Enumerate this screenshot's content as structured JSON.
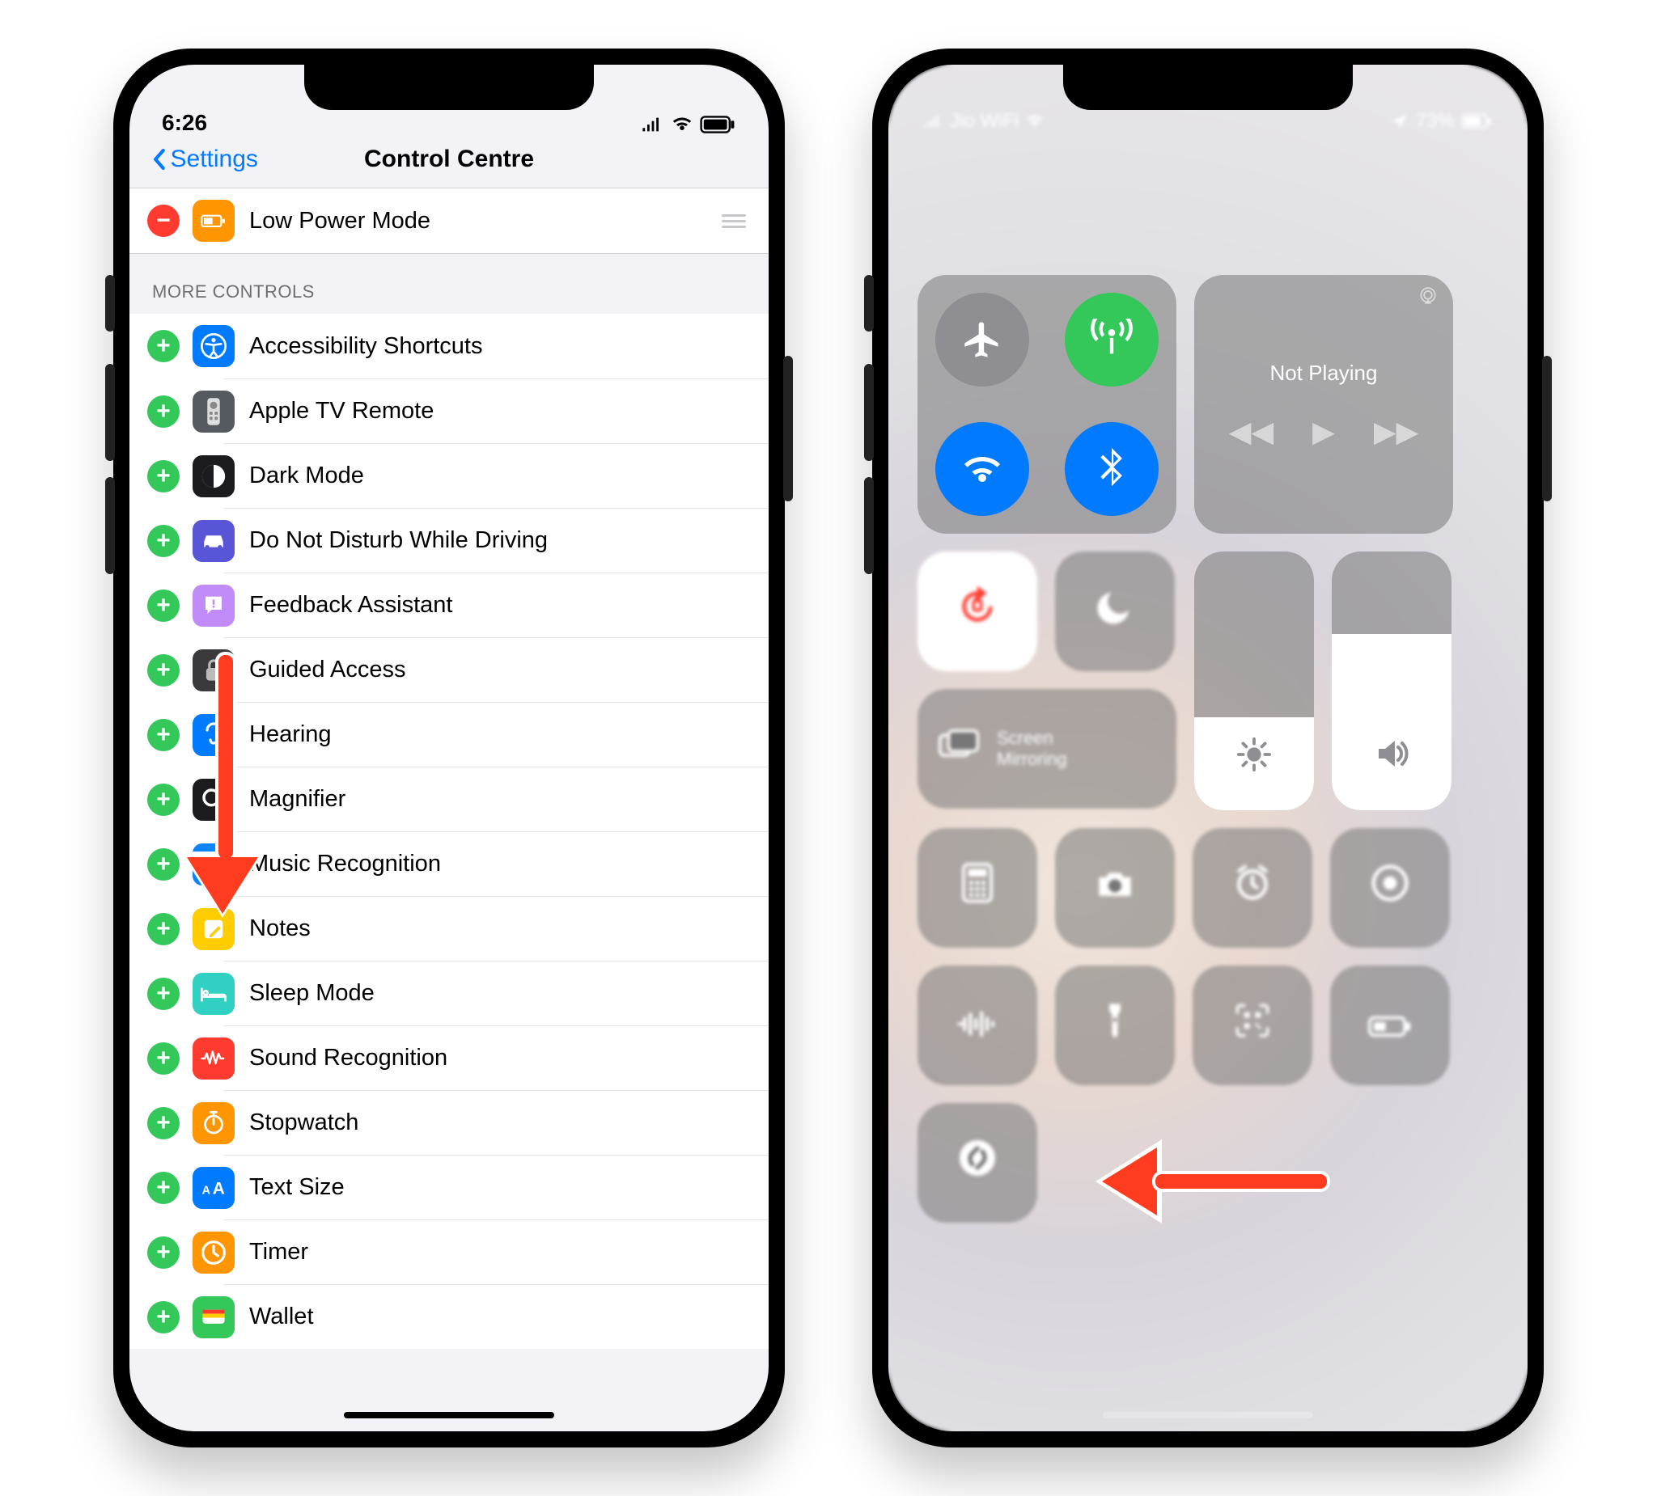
{
  "phone1": {
    "status": {
      "time": "6:26"
    },
    "nav": {
      "back": "Settings",
      "title": "Control Centre"
    },
    "included": [
      {
        "label": "Low Power Mode",
        "icon": "battery-icon",
        "icon_bg": "#ff9500"
      }
    ],
    "section_header": "MORE CONTROLS",
    "more": [
      {
        "label": "Accessibility Shortcuts",
        "icon": "accessibility-icon",
        "icon_bg": "#007aff"
      },
      {
        "label": "Apple TV Remote",
        "icon": "remote-icon",
        "icon_bg": "#555a60"
      },
      {
        "label": "Dark Mode",
        "icon": "darkmode-icon",
        "icon_bg": "#1c1c1e"
      },
      {
        "label": "Do Not Disturb While Driving",
        "icon": "car-icon",
        "icon_bg": "#5856d6"
      },
      {
        "label": "Feedback Assistant",
        "icon": "feedback-icon",
        "icon_bg": "#c18cf9"
      },
      {
        "label": "Guided Access",
        "icon": "lock-icon",
        "icon_bg": "#3a3a3c"
      },
      {
        "label": "Hearing",
        "icon": "ear-icon",
        "icon_bg": "#007aff"
      },
      {
        "label": "Magnifier",
        "icon": "magnifier-icon",
        "icon_bg": "#1c1c1e"
      },
      {
        "label": "Music Recognition",
        "icon": "shazam-icon",
        "icon_bg": "#0a84ff"
      },
      {
        "label": "Notes",
        "icon": "notes-icon",
        "icon_bg": "#ffcc00"
      },
      {
        "label": "Sleep Mode",
        "icon": "bed-icon",
        "icon_bg": "#30d0c3"
      },
      {
        "label": "Sound Recognition",
        "icon": "wave-icon",
        "icon_bg": "#ff3b30"
      },
      {
        "label": "Stopwatch",
        "icon": "stopwatch-icon",
        "icon_bg": "#ff9500"
      },
      {
        "label": "Text Size",
        "icon": "textsize-icon",
        "icon_bg": "#007aff"
      },
      {
        "label": "Timer",
        "icon": "timer-icon",
        "icon_bg": "#ff9500"
      },
      {
        "label": "Wallet",
        "icon": "wallet-icon",
        "icon_bg": "#34c759"
      }
    ]
  },
  "phone2": {
    "status": {
      "carrier": "Jio WiFi",
      "battery": "73%"
    },
    "now_playing": "Not Playing",
    "screen_mirroring": "Screen\nMirroring",
    "brightness_fill_pct": 36,
    "volume_fill_pct": 68,
    "connectivity": {
      "airplane": {
        "on": false,
        "bg": "#8e8e93"
      },
      "cellular": {
        "on": true,
        "bg": "#34c759"
      },
      "wifi": {
        "on": true,
        "bg": "#007aff"
      },
      "bluetooth": {
        "on": true,
        "bg": "#007aff"
      }
    },
    "tiles_row1": [
      "calculator",
      "camera",
      "alarm",
      "record"
    ],
    "tiles_row2": [
      "voice-memos",
      "flashlight",
      "qr-code",
      "low-power"
    ],
    "tiles_row3": [
      "shazam"
    ]
  }
}
